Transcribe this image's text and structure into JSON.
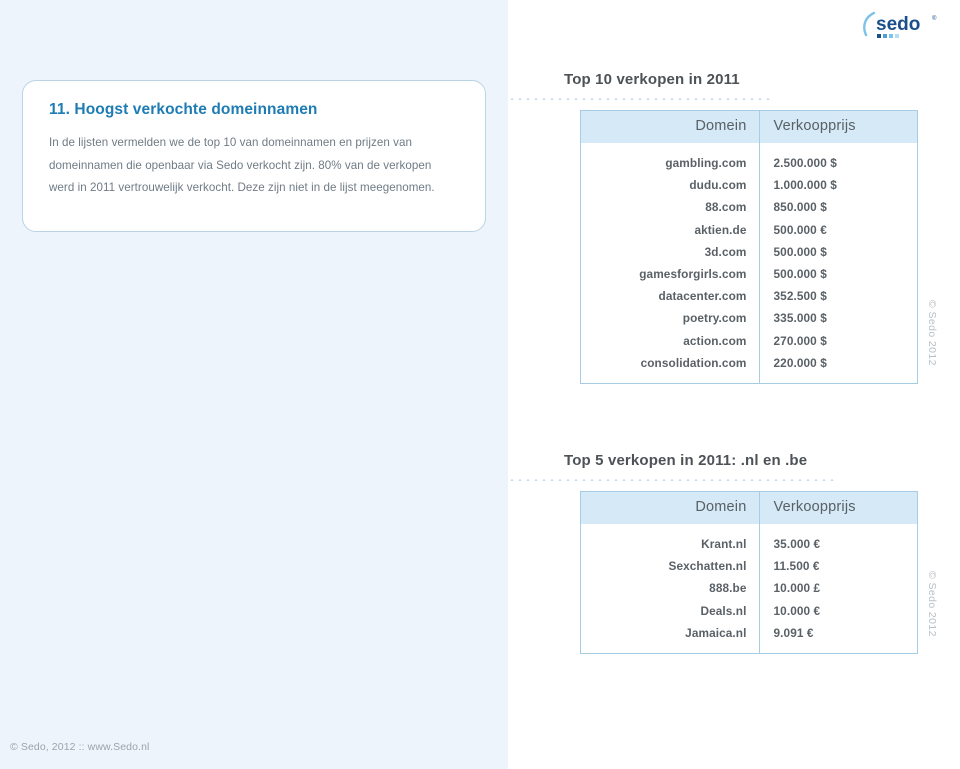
{
  "logo": {
    "wordmark": "sedo",
    "registered_mark": "®",
    "colors": {
      "dark_blue": "#1b4f8c",
      "light_blue": "#7cc3e8",
      "arc": "#7cc3e8"
    }
  },
  "info_box": {
    "title": "11. Hoogst verkochte domeinnamen",
    "body": "In de lijsten vermelden we de top 10 van domeinnamen en prijzen van domeinnamen die openbaar via Sedo verkocht zijn. 80% van de verkopen werd in 2011 vertrouwelijk verkocht. Deze zijn niet in de lijst meegenomen."
  },
  "table_top10": {
    "title": "Top 10 verkopen in 2011",
    "columns": [
      "Domein",
      "Verkoopprijs"
    ],
    "rows": [
      {
        "domain": "gambling.com",
        "price": "2.500.000 $"
      },
      {
        "domain": "dudu.com",
        "price": "1.000.000 $"
      },
      {
        "domain": "88.com",
        "price": "850.000 $"
      },
      {
        "domain": "aktien.de",
        "price": "500.000 €"
      },
      {
        "domain": "3d.com",
        "price": "500.000 $"
      },
      {
        "domain": "gamesforgirls.com",
        "price": "500.000 $"
      },
      {
        "domain": "datacenter.com",
        "price": "352.500 $"
      },
      {
        "domain": "poetry.com",
        "price": "335.000 $"
      },
      {
        "domain": "action.com",
        "price": "270.000 $"
      },
      {
        "domain": "consolidation.com",
        "price": "220.000 $"
      }
    ],
    "copyright": "© Sedo 2012"
  },
  "table_top5": {
    "title": "Top 5 verkopen in 2011: .nl en .be",
    "columns": [
      "Domein",
      "Verkoopprijs"
    ],
    "rows": [
      {
        "domain": "Krant.nl",
        "price": "35.000 €"
      },
      {
        "domain": "Sexchatten.nl",
        "price": "11.500 €"
      },
      {
        "domain": "888.be",
        "price": "10.000 £"
      },
      {
        "domain": "Deals.nl",
        "price": "10.000 €"
      },
      {
        "domain": "Jamaica.nl",
        "price": "9.091 €"
      }
    ],
    "copyright": "© Sedo 2012"
  },
  "footer": {
    "text": "© Sedo, 2012 :: www.Sedo.nl"
  },
  "theme": {
    "panel_bg": "#eef4fc",
    "heading_blue": "#1e7cb4",
    "table_header_bg": "#d6e9f7",
    "table_border": "#a7cde4",
    "body_text": "#6f7b85",
    "title_text": "#4d5257"
  }
}
